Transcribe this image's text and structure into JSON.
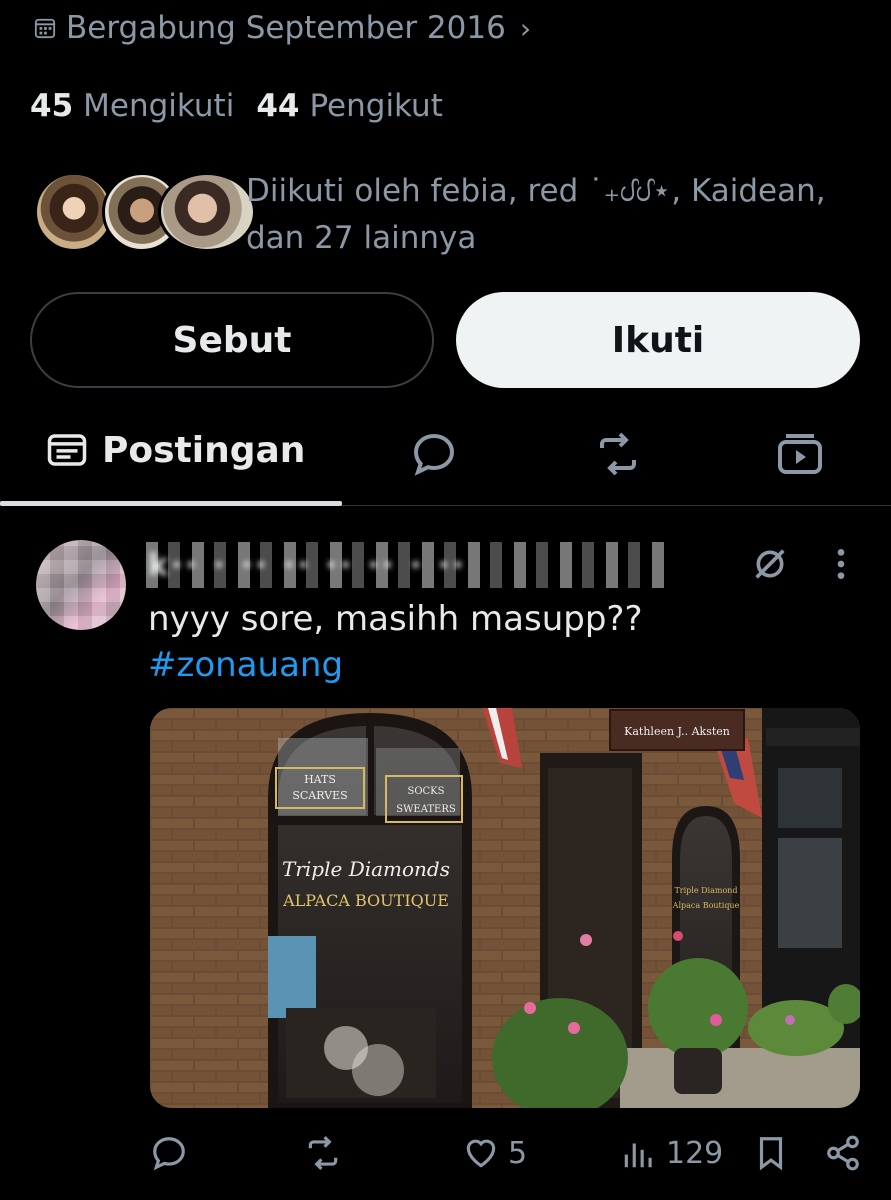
{
  "profile": {
    "joined": "Bergabung September 2016",
    "following_count": "45",
    "following_label": "Mengikuti",
    "followers_count": "44",
    "followers_label": "Pengikut",
    "followed_by": "Diikuti oleh febia, red ˙₊ᦔᦔ⋆, Kaidean, dan 27 lainnya"
  },
  "buttons": {
    "mention": "Sebut",
    "follow": "Ikuti"
  },
  "tabs": {
    "posts": "Postingan",
    "icons": [
      "posts-icon",
      "replies-icon",
      "reposts-icon",
      "media-icon"
    ]
  },
  "post": {
    "author_blurred": "k·· · ·· ·· ·· ·· · ··",
    "text": "nyyy sore, masihh masupp??",
    "hashtag": "#zonauang",
    "image": {
      "sign": "Kathleen J.. Aksten",
      "window_left_top": "HATS SCARVES",
      "window_right_top": "SOCKS SWEATERS",
      "shop_name": "Triple Diamonds",
      "shop_type": "Alpaca Boutique",
      "small_window": "Triple Diamond Alpaca Boutique"
    },
    "stats": {
      "likes": "5",
      "views": "129"
    }
  },
  "colors": {
    "background": "#000000",
    "text": "#e7e9ea",
    "muted": "#8b98a5",
    "link": "#1d9bf0",
    "follow_button": "#eff3f4"
  }
}
